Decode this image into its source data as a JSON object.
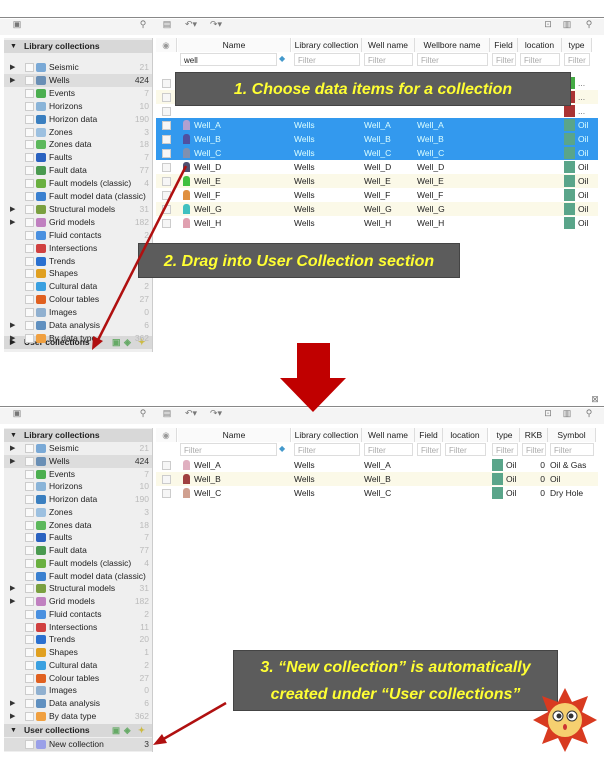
{
  "colors": {
    "accent_selection": "#3399ee",
    "type_swatch": "#5aa58a",
    "callout_bg": "#5c5c5c",
    "callout_text": "#ffff33",
    "arrow": "#b01010"
  },
  "callouts": {
    "step1": "1. Choose data items for a collection",
    "step2": "2. Drag into User Collection  section",
    "step3_line1": "3. “New collection” is automatically",
    "step3_line2": "created under “User collections”"
  },
  "sidebar": {
    "library_header": "Library collections",
    "user_header": "User collections",
    "items": [
      {
        "label": "Seismic",
        "count": "21",
        "exp": true,
        "icon": "#7aa9d6"
      },
      {
        "label": "Wells",
        "count": "424",
        "exp": true,
        "icon": "#6a8fb5",
        "sel": true
      },
      {
        "label": "Events",
        "count": "7",
        "icon": "#4caf50"
      },
      {
        "label": "Horizons",
        "count": "10",
        "icon": "#8ab4d8"
      },
      {
        "label": "Horizon data",
        "count": "190",
        "icon": "#3a7fc0"
      },
      {
        "label": "Zones",
        "count": "3",
        "icon": "#9cc0e0"
      },
      {
        "label": "Zones data",
        "count": "18",
        "icon": "#5cb85c"
      },
      {
        "label": "Faults",
        "count": "7",
        "icon": "#2a62c0"
      },
      {
        "label": "Fault data",
        "count": "77",
        "icon": "#4a9a50"
      },
      {
        "label": "Fault models (classic)",
        "count": "4",
        "icon": "#6ab040"
      },
      {
        "label": "Fault model data (classic)",
        "count": "",
        "icon": "#3a80d0"
      },
      {
        "label": "Structural models",
        "count": "31",
        "exp": true,
        "icon": "#7aa040"
      },
      {
        "label": "Grid models",
        "count": "182",
        "exp": true,
        "icon": "#c080c0"
      },
      {
        "label": "Fluid contacts",
        "count": "2",
        "icon": "#4a90e0"
      },
      {
        "label": "Intersections",
        "count": "11",
        "icon": "#d04040"
      },
      {
        "label": "Trends",
        "count": "20",
        "icon": "#2a70d0"
      },
      {
        "label": "Shapes",
        "count": "1",
        "icon": "#e0a020"
      },
      {
        "label": "Cultural data",
        "count": "2",
        "icon": "#3aa0e0"
      },
      {
        "label": "Colour tables",
        "count": "27",
        "icon": "#e06020"
      },
      {
        "label": "Images",
        "count": "0",
        "icon": "#90b0d0"
      },
      {
        "label": "Data analysis",
        "count": "6",
        "exp": true,
        "icon": "#6090c0"
      },
      {
        "label": "By data type",
        "count": "362",
        "exp": true,
        "icon": "#f0a040"
      }
    ],
    "new_collection": {
      "label": "New collection",
      "count": "3"
    }
  },
  "top_table": {
    "columns": [
      "Name",
      "Library collection",
      "Well name",
      "Wellbore name",
      "Field",
      "location",
      "type"
    ],
    "name_filter": "well",
    "filter_placeholder": "Filter",
    "hidden_rows": [
      {
        "type": "..."
      },
      {
        "type": "..."
      },
      {
        "type": "..."
      }
    ],
    "rows": [
      {
        "name": "Well_A",
        "lib": "Wells",
        "well": "Well_A",
        "wellbore": "Well_A",
        "type": "Oil",
        "sel": true,
        "icon": "#b0a0d0"
      },
      {
        "name": "Well_B",
        "lib": "Wells",
        "well": "Well_B",
        "wellbore": "Well_B",
        "type": "Oil",
        "sel": true,
        "icon": "#5050a0"
      },
      {
        "name": "Well_C",
        "lib": "Wells",
        "well": "Well_C",
        "wellbore": "Well_C",
        "type": "Oil",
        "sel": true,
        "icon": "#8090b0"
      },
      {
        "name": "Well_D",
        "lib": "Wells",
        "well": "Well_D",
        "wellbore": "Well_D",
        "type": "Oil",
        "icon": "#505070"
      },
      {
        "name": "Well_E",
        "lib": "Wells",
        "well": "Well_E",
        "wellbore": "Well_E",
        "type": "Oil",
        "icon": "#40c040"
      },
      {
        "name": "Well_F",
        "lib": "Wells",
        "well": "Well_F",
        "wellbore": "Well_F",
        "type": "Oil",
        "icon": "#e09040"
      },
      {
        "name": "Well_G",
        "lib": "Wells",
        "well": "Well_G",
        "wellbore": "Well_G",
        "type": "Oil",
        "icon": "#40c0c0"
      },
      {
        "name": "Well_H",
        "lib": "Wells",
        "well": "Well_H",
        "wellbore": "Well_H",
        "type": "Oil",
        "icon": "#e0a0b0"
      }
    ]
  },
  "bottom_table": {
    "columns": [
      "Name",
      "Library collection",
      "Well name",
      "Field",
      "location",
      "type",
      "RKB",
      "Symbol"
    ],
    "filter_placeholder": "Filter",
    "rows": [
      {
        "name": "Well_A",
        "lib": "Wells",
        "well": "Well_A",
        "type": "Oil",
        "rkb": "0",
        "symbol": "Oil & Gas",
        "icon": "#e0b0c0"
      },
      {
        "name": "Well_B",
        "lib": "Wells",
        "well": "Well_B",
        "type": "Oil",
        "rkb": "0",
        "symbol": "Oil",
        "icon": "#a04040"
      },
      {
        "name": "Well_C",
        "lib": "Wells",
        "well": "Well_C",
        "type": "Oil",
        "rkb": "0",
        "symbol": "Dry Hole",
        "icon": "#d0a090"
      }
    ]
  }
}
